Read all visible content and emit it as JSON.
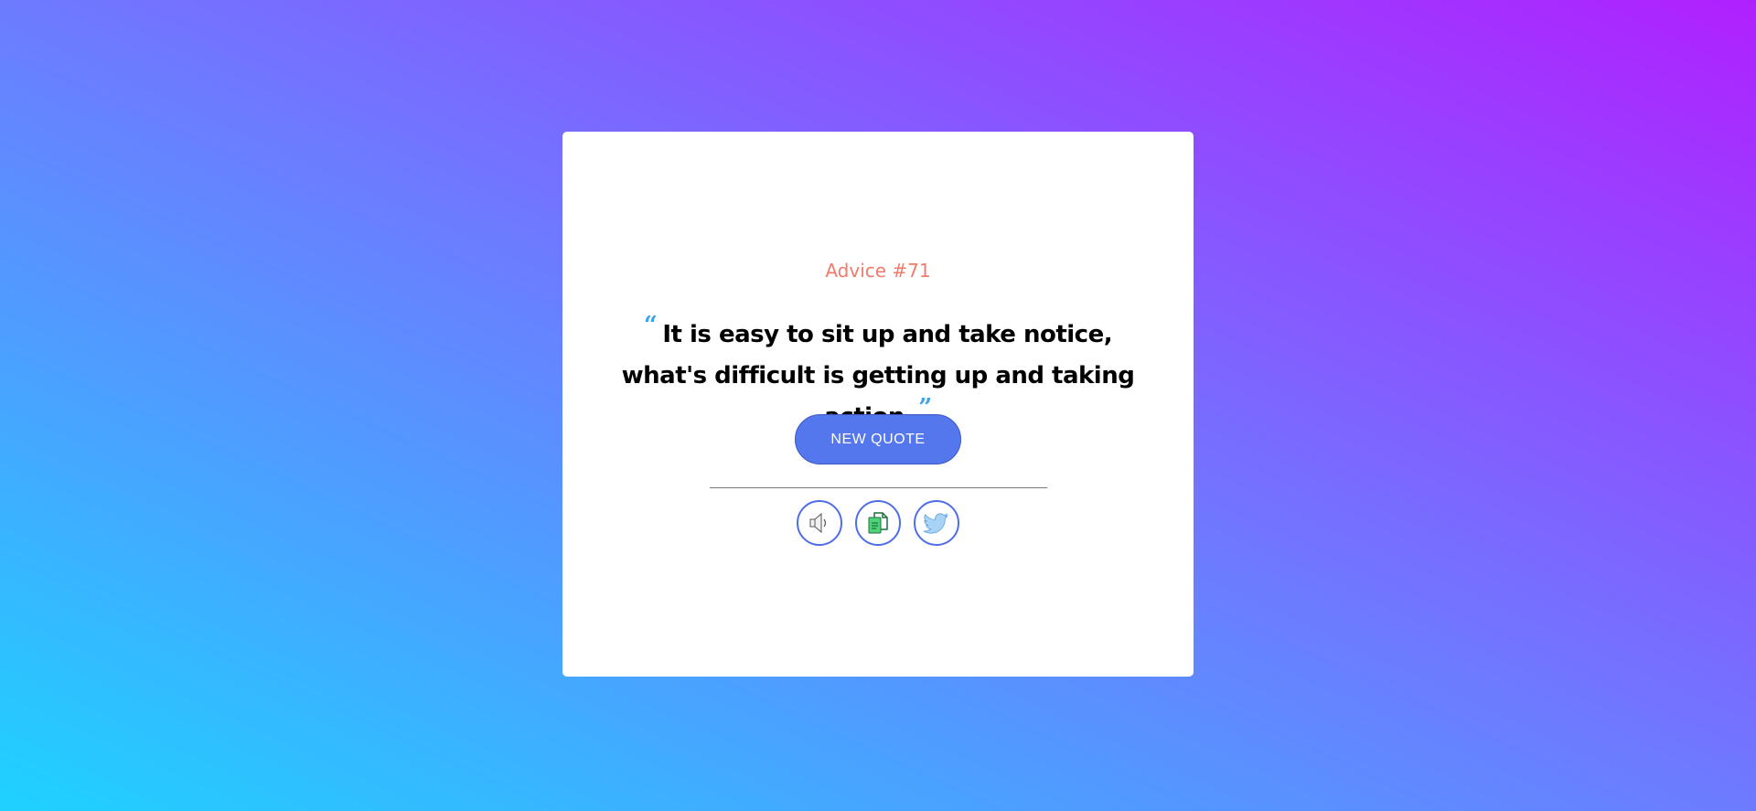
{
  "advice": {
    "label": "Advice #71",
    "open_mark": "“",
    "close_mark": "”",
    "text": "It is easy to sit up and take notice, what's difficult is getting up and taking action."
  },
  "button": {
    "label": "NEW QUOTE"
  },
  "actions": [
    {
      "icon": "speaker-icon"
    },
    {
      "icon": "copy-icon"
    },
    {
      "icon": "twitter-icon"
    }
  ],
  "colors": {
    "accent": "#5477ed",
    "advice_label": "#f07c6c",
    "quote_marks": "#3fa3e8",
    "gradient_start": "#1ed2ff",
    "gradient_end": "#b020ff"
  }
}
